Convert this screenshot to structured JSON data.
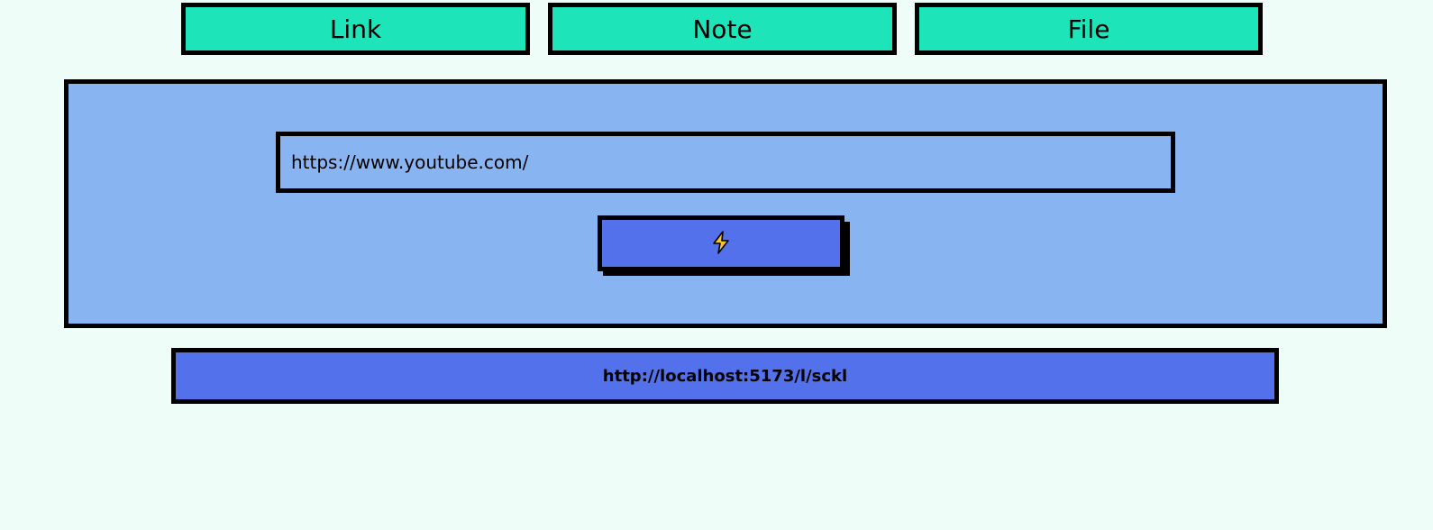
{
  "tabs": [
    {
      "label": "Link"
    },
    {
      "label": "Note"
    },
    {
      "label": "File"
    }
  ],
  "form": {
    "url_value": "https://www.youtube.com/",
    "submit_icon": "lightning-icon"
  },
  "result": {
    "short_url": "http://localhost:5173/l/sckl"
  },
  "colors": {
    "background": "#effdf9",
    "tab": "#1de4b9",
    "panel": "#89b4f2",
    "button": "#5271ea",
    "icon": "#f6c331"
  }
}
